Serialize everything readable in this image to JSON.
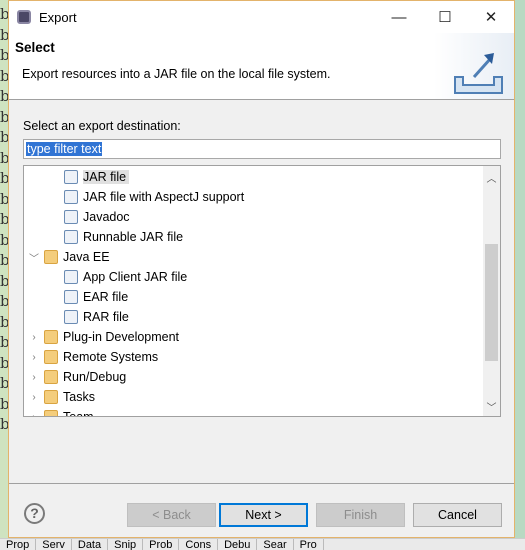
{
  "window": {
    "title": "Export",
    "minimize": "—",
    "maximize": "☐",
    "close": "✕"
  },
  "header": {
    "title": "Select",
    "description": "Export resources into a JAR file on the local file system."
  },
  "filter": {
    "label": "Select an export destination:",
    "value": "type filter text"
  },
  "tree": [
    {
      "label": "JAR file",
      "level": 2,
      "type": "file",
      "selected": true
    },
    {
      "label": "JAR file with AspectJ support",
      "level": 2,
      "type": "file"
    },
    {
      "label": "Javadoc",
      "level": 2,
      "type": "file"
    },
    {
      "label": "Runnable JAR file",
      "level": 2,
      "type": "file"
    },
    {
      "label": "Java EE",
      "level": 1,
      "type": "folder",
      "expanded": true
    },
    {
      "label": "App Client JAR file",
      "level": 2,
      "type": "file"
    },
    {
      "label": "EAR file",
      "level": 2,
      "type": "file"
    },
    {
      "label": "RAR file",
      "level": 2,
      "type": "file"
    },
    {
      "label": "Plug-in Development",
      "level": 1,
      "type": "folder",
      "expanded": false
    },
    {
      "label": "Remote Systems",
      "level": 1,
      "type": "folder",
      "expanded": false
    },
    {
      "label": "Run/Debug",
      "level": 1,
      "type": "folder",
      "expanded": false
    },
    {
      "label": "Tasks",
      "level": 1,
      "type": "folder",
      "expanded": false
    },
    {
      "label": "Team",
      "level": 1,
      "type": "folder",
      "expanded": false
    }
  ],
  "buttons": {
    "back": "< Back",
    "next": "Next >",
    "finish": "Finish",
    "cancel": "Cancel",
    "help": "?"
  },
  "taskbar": [
    "Prop",
    "Serv",
    "Data",
    "Snip",
    "Prob",
    "Cons",
    "Debu",
    "Sear",
    "Pro"
  ]
}
